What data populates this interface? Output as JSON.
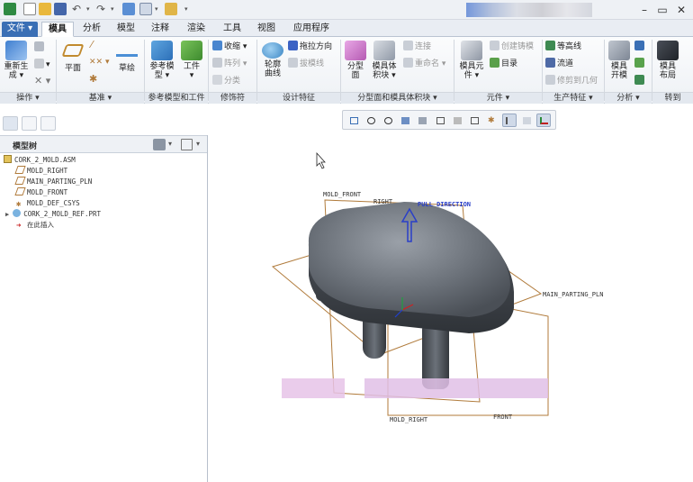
{
  "quick_access": {
    "icons": [
      "app-icon",
      "new-icon",
      "open-icon",
      "save-icon",
      "undo-icon",
      "redo-icon",
      "regenerate-icon",
      "windows-icon",
      "close-window-icon",
      "customize-icon"
    ]
  },
  "window_controls": {
    "minimize": "–",
    "restore": "▭",
    "close": "✕"
  },
  "tabs": [
    {
      "label": "文件 ▾",
      "active": false
    },
    {
      "label": "模具",
      "active": true
    },
    {
      "label": "分析",
      "active": false
    },
    {
      "label": "模型",
      "active": false
    },
    {
      "label": "注释",
      "active": false
    },
    {
      "label": "渲染",
      "active": false
    },
    {
      "label": "工具",
      "active": false
    },
    {
      "label": "视图",
      "active": false
    },
    {
      "label": "应用程序",
      "active": false
    }
  ],
  "ribbon": {
    "regenerate": "重新生\n成 ▾",
    "plane": "平面",
    "sketch": "草绘",
    "ref_model": "参考模\n型 ▾",
    "workpiece": "工件\n▾",
    "shrink": "收缩 ▾",
    "array": "阵列 ▾",
    "split": "分类",
    "silhouette": "轮廓\n曲线",
    "drag_direction": "拖拉方向",
    "draft_line": "拔模线",
    "parting_surface": "分型\n面",
    "mold_volume": "模具体\n积块 ▾",
    "connect": "连接",
    "rename": "重命名 ▾",
    "mold_component": "模具元\n件 ▾",
    "create_cast": "创建铸模",
    "catalog": "目录",
    "contour": "等高线",
    "runner": "流道",
    "trim_geometry": "修剪到几何",
    "mold_open": "模具\n开模",
    "mold_layout": "模具\n布局",
    "groups": [
      {
        "label": "操作 ▾"
      },
      {
        "label": "基准 ▾"
      },
      {
        "label": "参考模型和工件"
      },
      {
        "label": "修饰符"
      },
      {
        "label": "设计特征"
      },
      {
        "label": "分型面和模具体积块 ▾"
      },
      {
        "label": "元件 ▾"
      },
      {
        "label": "生产特征 ▾"
      },
      {
        "label": "分析 ▾"
      },
      {
        "label": "转到"
      }
    ]
  },
  "view_toolbar": {
    "icons": [
      "refit-icon",
      "zoom-in-icon",
      "zoom-out-icon",
      "repaint-icon",
      "display-style-icon",
      "saved-views-icon",
      "view-manager-icon",
      "perspective-icon",
      "datum-display-icon",
      "annotation-icon",
      "spin-center-icon",
      "csys-display-icon"
    ]
  },
  "model_tree": {
    "title": "模型树",
    "items": [
      {
        "label": "CORK_2_MOLD.ASM",
        "icon": "assembly-icon",
        "indent": 0
      },
      {
        "label": "MOLD_RIGHT",
        "icon": "datum-plane-icon",
        "indent": 1
      },
      {
        "label": "MAIN_PARTING_PLN",
        "icon": "datum-plane-icon",
        "indent": 1
      },
      {
        "label": "MOLD_FRONT",
        "icon": "datum-plane-icon",
        "indent": 1
      },
      {
        "label": "MOLD_DEF_CSYS",
        "icon": "csys-icon",
        "indent": 1
      },
      {
        "label": "CORK_2_MOLD_REF.PRT",
        "icon": "part-icon",
        "indent": 1
      },
      {
        "label": "在此插入",
        "icon": "insert-arrow-icon",
        "indent": 1
      }
    ]
  },
  "viewport": {
    "labels": {
      "mold_front": "MOLD_FRONT",
      "right": "RIGHT",
      "pull_direction": "PULL DIRECTION",
      "main_parting": "MAIN_PARTING_PLN",
      "mold_right": "MOLD_RIGHT",
      "front": "FRONT"
    }
  },
  "colors": {
    "accent": "#3a6fb5",
    "datum_plane": "#b07a3a",
    "pull_arrow": "#2a3fc8",
    "model": "#5b6068"
  }
}
